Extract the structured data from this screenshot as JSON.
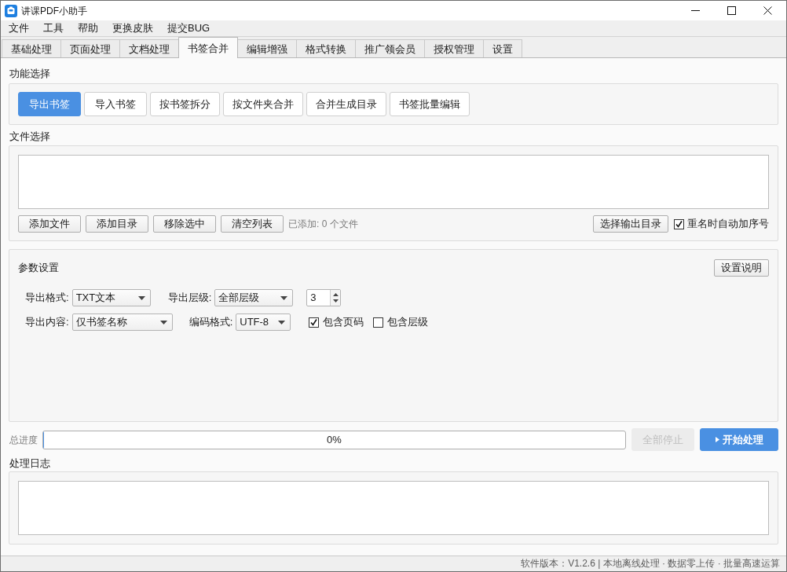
{
  "window": {
    "title": "讲课PDF小助手"
  },
  "menu": [
    "文件",
    "工具",
    "帮助",
    "更换皮肤",
    "提交BUG"
  ],
  "tabs": [
    {
      "label": "基础处理",
      "selected": false
    },
    {
      "label": "页面处理",
      "selected": false
    },
    {
      "label": "文档处理",
      "selected": false
    },
    {
      "label": "书签合并",
      "selected": true
    },
    {
      "label": "编辑增强",
      "selected": false
    },
    {
      "label": "格式转换",
      "selected": false
    },
    {
      "label": "推广领会员",
      "selected": false
    },
    {
      "label": "授权管理",
      "selected": false
    },
    {
      "label": "设置",
      "selected": false
    }
  ],
  "function_select": {
    "title": "功能选择",
    "buttons": [
      {
        "label": "导出书签",
        "selected": true
      },
      {
        "label": "导入书签",
        "selected": false
      },
      {
        "label": "按书签拆分",
        "selected": false
      },
      {
        "label": "按文件夹合并",
        "selected": false
      },
      {
        "label": "合并生成目录",
        "selected": false
      },
      {
        "label": "书签批量编辑",
        "selected": false
      }
    ]
  },
  "file_select": {
    "title": "文件选择",
    "buttons": [
      "添加文件",
      "添加目录",
      "移除选中",
      "清空列表"
    ],
    "count_text": "已添加: 0 个文件",
    "output_button": "选择输出目录",
    "auto_number": {
      "label": "重名时自动加序号",
      "checked": true
    }
  },
  "params": {
    "title": "参数设置",
    "help_button": "设置说明",
    "rows": [
      [
        {
          "kind": "select",
          "label": "导出格式:",
          "value": "TXT文本"
        },
        {
          "kind": "select",
          "label": "导出层级:",
          "value": "全部层级"
        },
        {
          "kind": "spin",
          "value": "3"
        }
      ],
      [
        {
          "kind": "select",
          "label": "导出内容:",
          "value": "仅书签名称"
        },
        {
          "kind": "select",
          "label": "编码格式:",
          "value": "UTF-8"
        },
        {
          "kind": "checkbox",
          "label": "包含页码",
          "checked": true
        },
        {
          "kind": "checkbox",
          "label": "包含层级",
          "checked": false
        }
      ]
    ]
  },
  "progress": {
    "label": "总进度",
    "level": 0,
    "reading": "0%"
  },
  "actions": [
    {
      "kind": "stop",
      "label": "全部停止",
      "disabled": true
    },
    {
      "kind": "start",
      "label": "开始处理",
      "disabled": false
    }
  ],
  "log": {
    "title": "处理日志"
  },
  "status_bar": "软件版本：V1.2.6 | 本地离线处理 · 数据零上传 · 批量高速运算"
}
